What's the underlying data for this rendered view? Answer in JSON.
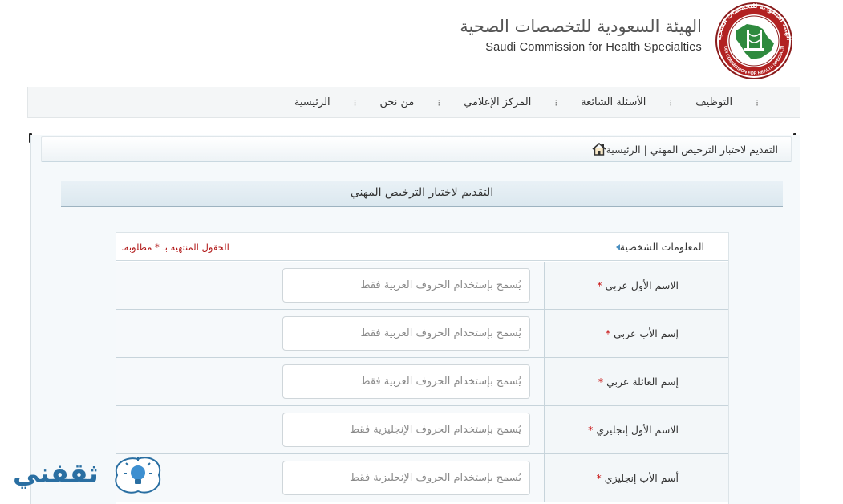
{
  "header": {
    "brand_ar": "الهيئة السعودية للتخصصات الصحية",
    "brand_en": "Saudi Commission for Health Specialties",
    "logo_ring_ar": "الهيئة السعودية للتخصصات الصحية",
    "logo_ring_en": "SAUDI COMMISSION FOR HEALTH SPECIALTIES"
  },
  "nav": {
    "items": [
      {
        "label": "الرئيسية"
      },
      {
        "label": "من نحن"
      },
      {
        "label": "المركز الإعلامي"
      },
      {
        "label": "الأسئلة الشائعة"
      },
      {
        "label": "التوظيف"
      }
    ],
    "separator": "⁝"
  },
  "breadcrumb": {
    "home": "الرئيسية",
    "separator": "|",
    "current": "التقديم لاختبار الترخيص المهني"
  },
  "page": {
    "title": "التقديم لاختبار الترخيص المهني"
  },
  "form": {
    "section_title": "المعلومات الشخصية",
    "required_note": "الحقول المنتهية بـ * مطلوبة.",
    "required_mark": "*",
    "fields": [
      {
        "label": "الاسم الأول عربي",
        "placeholder": "يُسمح بإستخدام الحروف العربية فقط",
        "value": ""
      },
      {
        "label": "إسم الأب عربي",
        "placeholder": "يُسمح بإستخدام الحروف العربية فقط",
        "value": ""
      },
      {
        "label": "إسم العائلة عربي",
        "placeholder": "يُسمح بإستخدام الحروف العربية فقط",
        "value": ""
      },
      {
        "label": "الاسم الأول إنجليزي",
        "placeholder": "يُسمح بإستخدام الحروف الإنجليزية فقط",
        "value": ""
      },
      {
        "label": "أسم الأب إنجليزي",
        "placeholder": "يُسمح بإستخدام الحروف الإنجليزية فقط",
        "value": ""
      }
    ]
  },
  "watermark": {
    "text": "ثقفني"
  },
  "colors": {
    "accent": "#4a8fc0",
    "required": "#c81010",
    "logo_green": "#2e8a3e",
    "logo_red": "#b22222",
    "watermark": "#2a6fa2"
  },
  "icons": {
    "home": "home-icon",
    "section": "triangle-left-icon",
    "watermark": "lightbulb-icon"
  }
}
